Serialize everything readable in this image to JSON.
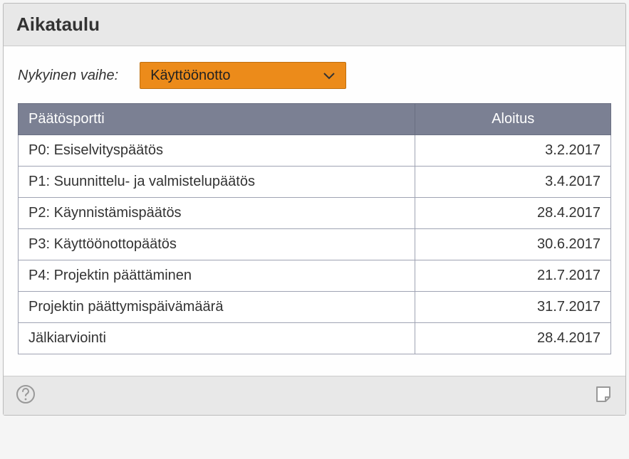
{
  "panel": {
    "title": "Aikataulu"
  },
  "phase": {
    "label": "Nykyinen vaihe:",
    "selected": "Käyttöönotto"
  },
  "table": {
    "headers": {
      "port": "Päätösportti",
      "start": "Aloitus"
    },
    "rows": [
      {
        "port": "P0: Esiselvityspäätös",
        "start": "3.2.2017"
      },
      {
        "port": "P1: Suunnittelu- ja valmistelupäätös",
        "start": "3.4.2017"
      },
      {
        "port": "P2: Käynnistämispäätös",
        "start": "28.4.2017"
      },
      {
        "port": "P3: Käyttöönottopäätös",
        "start": "30.6.2017"
      },
      {
        "port": "P4: Projektin päättäminen",
        "start": "21.7.2017"
      },
      {
        "port": "Projektin päättymispäivämäärä",
        "start": "31.7.2017"
      },
      {
        "port": "Jälkiarviointi",
        "start": "28.4.2017"
      }
    ]
  },
  "icons": {
    "help": "help-icon",
    "note": "note-icon"
  }
}
